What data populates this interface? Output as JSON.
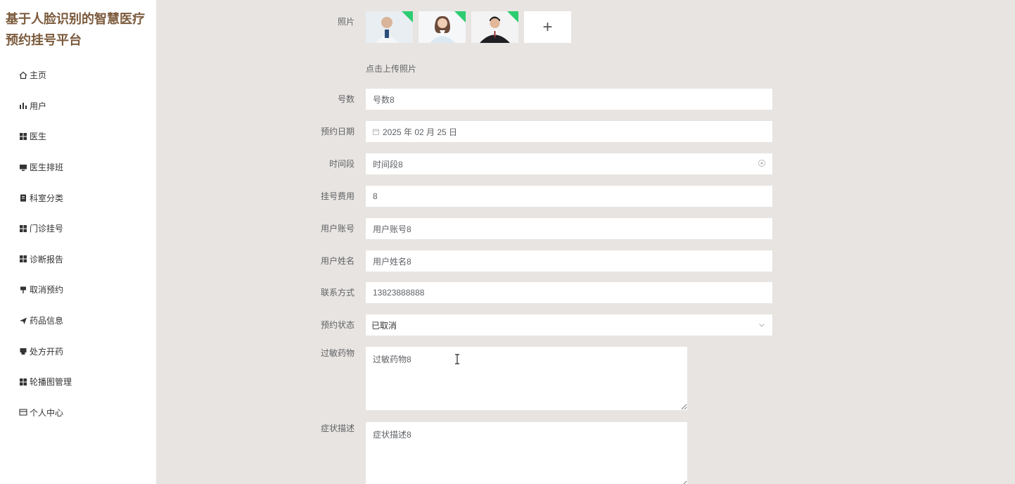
{
  "app": {
    "title": "基于人脸识别的智慧医疗预约挂号平台"
  },
  "sidebar": {
    "items": [
      {
        "label": "主页",
        "icon": "home-icon"
      },
      {
        "label": "用户",
        "icon": "bar-chart-icon"
      },
      {
        "label": "医生",
        "icon": "grid-icon"
      },
      {
        "label": "医生排班",
        "icon": "monitor-icon"
      },
      {
        "label": "科室分类",
        "icon": "clipboard-icon"
      },
      {
        "label": "门诊挂号",
        "icon": "grid-icon"
      },
      {
        "label": "诊断报告",
        "icon": "grid-icon"
      },
      {
        "label": "取消预约",
        "icon": "pin-icon"
      },
      {
        "label": "药品信息",
        "icon": "send-icon"
      },
      {
        "label": "处方开药",
        "icon": "printer-icon"
      },
      {
        "label": "轮播图管理",
        "icon": "grid-icon"
      },
      {
        "label": "个人中心",
        "icon": "card-icon"
      }
    ]
  },
  "form": {
    "photo_label": "照片",
    "upload_hint": "点击上传照片",
    "add_symbol": "+",
    "number_label": "号数",
    "number_value": "号数8",
    "date_label": "预约日期",
    "date_value": "2025 年 02 月 25 日",
    "timeslot_label": "时间段",
    "timeslot_value": "时间段8",
    "fee_label": "挂号费用",
    "fee_value": "8",
    "account_label": "用户账号",
    "account_value": "用户账号8",
    "name_label": "用户姓名",
    "name_value": "用户姓名8",
    "phone_label": "联系方式",
    "phone_value": "13823888888",
    "status_label": "预约状态",
    "status_value": "已取消",
    "allergy_label": "过敏药物",
    "allergy_value": "过敏药物8",
    "symptom_label": "症状描述",
    "symptom_value": "症状描述8"
  },
  "colors": {
    "title": "#7b5a3c",
    "background": "#e8e4e1",
    "badge": "#2ecc71"
  }
}
